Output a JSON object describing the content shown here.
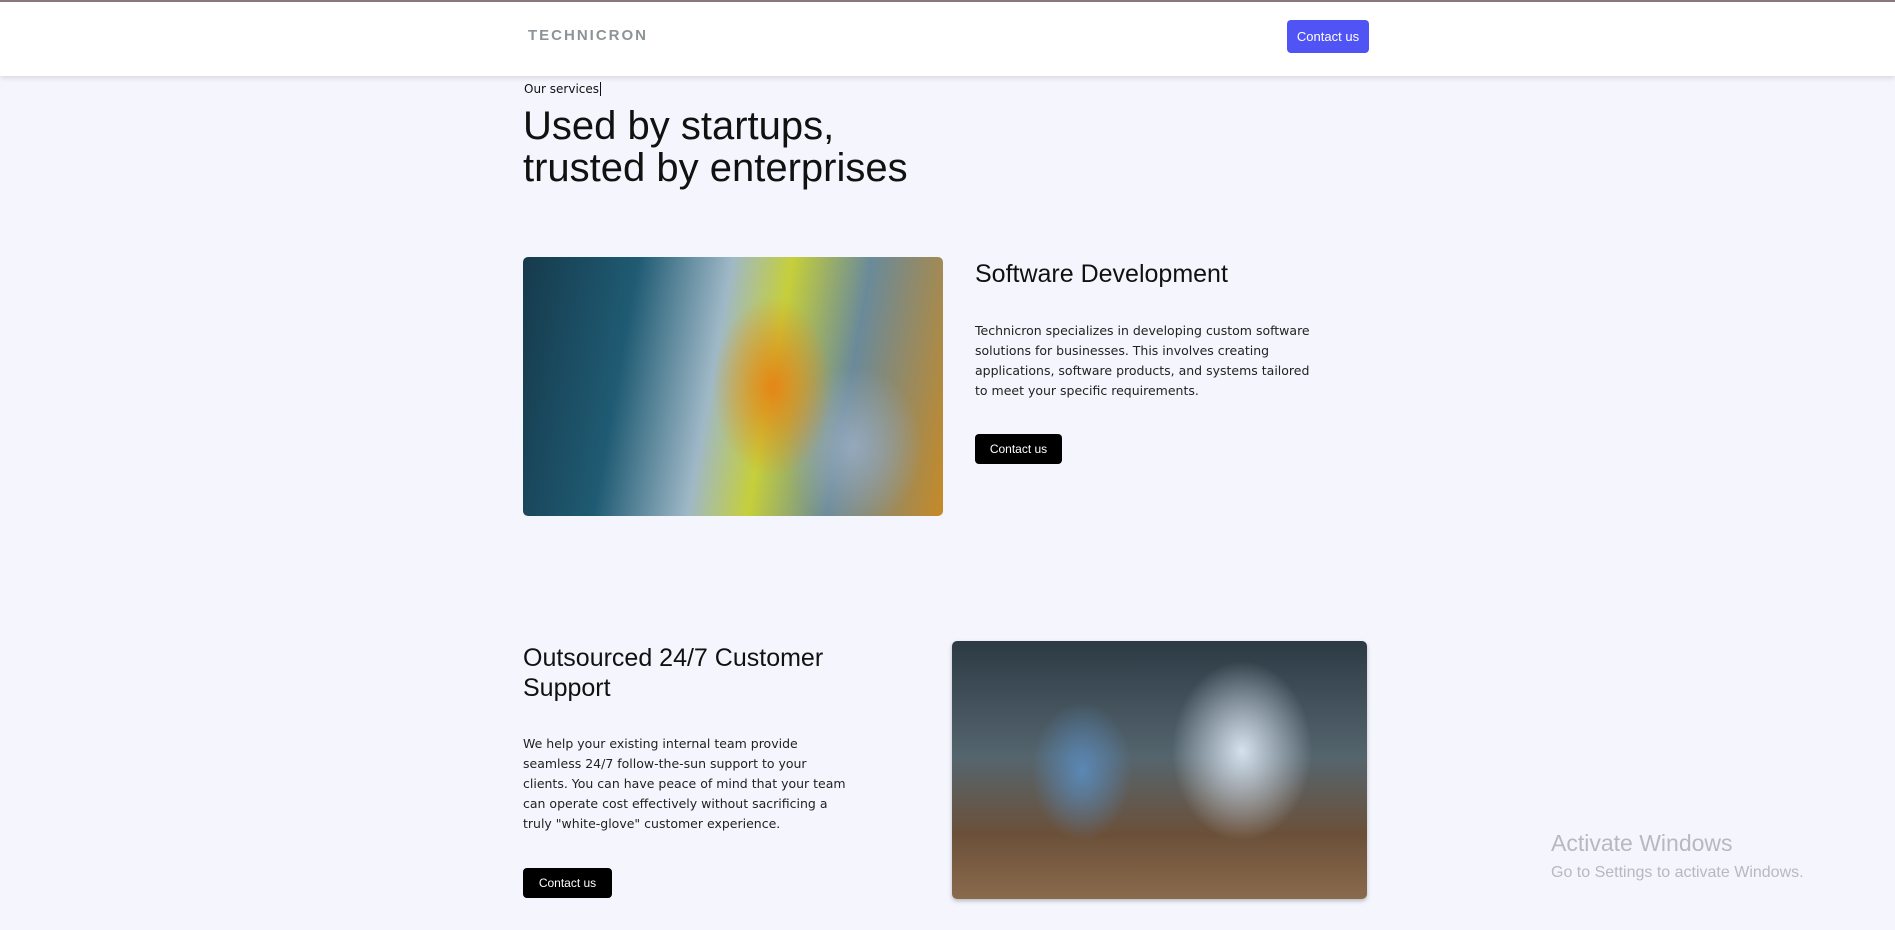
{
  "header": {
    "logo": "TECHNICRON",
    "contact_label": "Contact us",
    "accent_color": "#5154f5"
  },
  "hero": {
    "eyebrow": "Our services",
    "title_line1": "Used by startups,",
    "title_line2": "trusted by enterprises"
  },
  "services": [
    {
      "title": "Software Development",
      "description": "Technicron specializes in developing custom software solutions for businesses. This involves creating applications, software products, and systems tailored to meet your specific requirements.",
      "button_label": "Contact us"
    },
    {
      "title": "Outsourced 24/7 Customer Support",
      "description": "We help your existing internal team provide seamless 24/7 follow-the-sun support to your clients. You can have peace of mind that your team can operate cost effectively without sacrificing a truly \"white-glove\" customer experience.",
      "button_label": "Contact us"
    }
  ],
  "watermark": {
    "line1": "Activate Windows",
    "line2": "Go to Settings to activate Windows."
  }
}
